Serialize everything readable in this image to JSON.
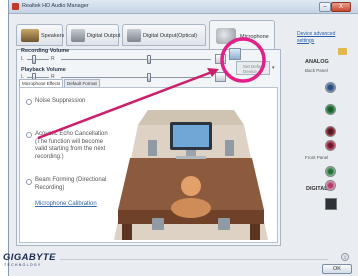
{
  "window": {
    "title": "Realtek HD Audio Manager",
    "icon": "speaker-app-icon",
    "controls": {
      "minimize": "–",
      "close": "X"
    }
  },
  "tabs": [
    {
      "label": "Speakers",
      "icon": "speaker-icon",
      "active": false
    },
    {
      "label": "Digital Output",
      "icon": "digital-output-icon",
      "active": false
    },
    {
      "label": "Digital Output(Optical)",
      "icon": "optical-output-icon",
      "active": false
    },
    {
      "label": "Microphone",
      "icon": "microphone-icon",
      "active": true
    }
  ],
  "volume": {
    "recording_label": "Recording Volume",
    "playback_label": "Playback Volume",
    "left": "L",
    "right": "R",
    "set_default": "Set Default Device"
  },
  "subtabs": [
    {
      "label": "Microphone Effects",
      "active": true
    },
    {
      "label": "Default Format",
      "active": false
    }
  ],
  "effects": {
    "noise_suppression": "Noise Suppression",
    "echo_cancellation": "Acoustic Echo Cancellation (The function will become valid starting from the next recording.)",
    "beam_forming": "Beam Forming (Directional Recording)",
    "calibration": "Microphone Calibration"
  },
  "sidebar": {
    "advanced_link": "Device advanced settings",
    "analog": "ANALOG",
    "back_panel": "Back Panel",
    "front_panel": "Front Panel",
    "digital": "DIGITAL"
  },
  "footer": {
    "brand": "GIGABYTE",
    "brand_sub": "TECHNOLOGY",
    "ok": "OK",
    "info": "i"
  },
  "colors": {
    "highlight_circle": "#e0218a",
    "pointer_arrow": "#cc1f6a",
    "link": "#2a5fad"
  }
}
